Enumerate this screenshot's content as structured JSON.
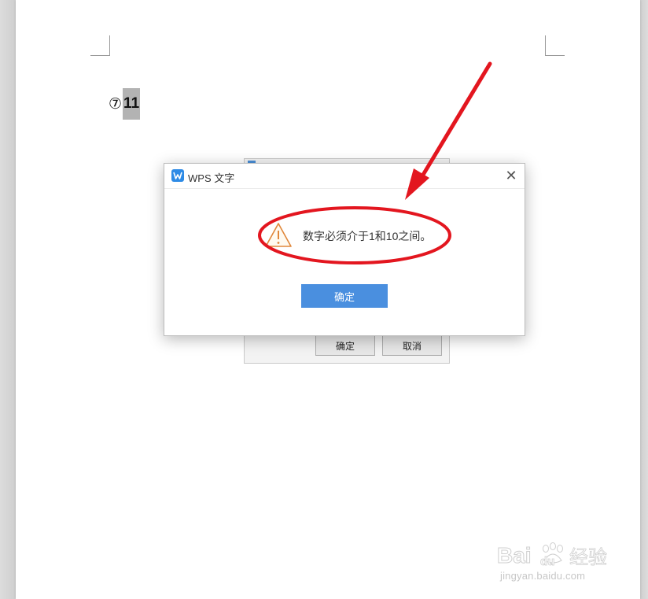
{
  "document": {
    "circled_number": "⑦",
    "selected_text": "11"
  },
  "background_dialog": {
    "ok_label": "确定",
    "cancel_label": "取消"
  },
  "message_dialog": {
    "title": "WPS 文字",
    "message": "数字必须介于1和10之间。",
    "ok_label": "确定",
    "close_symbol": "✕",
    "warning_icon": "warning-triangle-icon",
    "accent_color": "#4a8fdf"
  },
  "annotation": {
    "color": "#e3161f"
  },
  "watermark": {
    "logo_text": "Bai du 经验",
    "url": "jingyan.baidu.com"
  }
}
